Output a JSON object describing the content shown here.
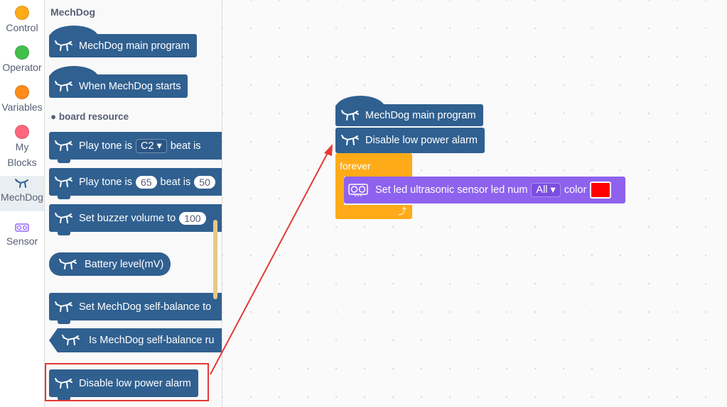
{
  "categories": [
    {
      "label": "Control",
      "color": "#ffab19"
    },
    {
      "label": "Operator",
      "color": "#40bf4a"
    },
    {
      "label": "Variables",
      "color": "#ff8c1a"
    },
    {
      "label_line1": "My",
      "label_line2": "Blocks",
      "color": "#ff6680"
    },
    {
      "label": "MechDog",
      "icon": "mechdog-icon",
      "selected": true
    },
    {
      "label": "Sensor",
      "icon": "sensor-icon",
      "color": "#9966ff"
    }
  ],
  "flyout": {
    "title": "MechDog",
    "section_board": "● board resource",
    "blocks": {
      "main_program": "MechDog main program",
      "when_starts": "When MechDog starts",
      "play_tone_1": {
        "prefix": "Play tone is",
        "note": "C2",
        "suffix": "beat is"
      },
      "play_tone_2": {
        "prefix": "Play tone is",
        "freq": "65",
        "suffix": "beat is",
        "beat": "50"
      },
      "buzzer_volume": {
        "prefix": "Set buzzer volume to",
        "value": "100"
      },
      "battery": "Battery level(mV)",
      "self_balance_set": "Set MechDog self-balance to",
      "self_balance_is": "Is MechDog self-balance ru",
      "disable_alarm": "Disable low power alarm"
    }
  },
  "workspace": {
    "main_program": "MechDog main program",
    "disable_alarm": "Disable low power alarm",
    "forever": "forever",
    "led_block": {
      "prefix": "Set led ultrasonic sensor led num",
      "num": "All",
      "color_label": "color",
      "color": "#ff0000"
    }
  },
  "colors": {
    "motion_blue": "#306090",
    "control_orange": "#ffab19",
    "sensor_purple": "#8e62ee",
    "highlight_red": "#e53935"
  }
}
